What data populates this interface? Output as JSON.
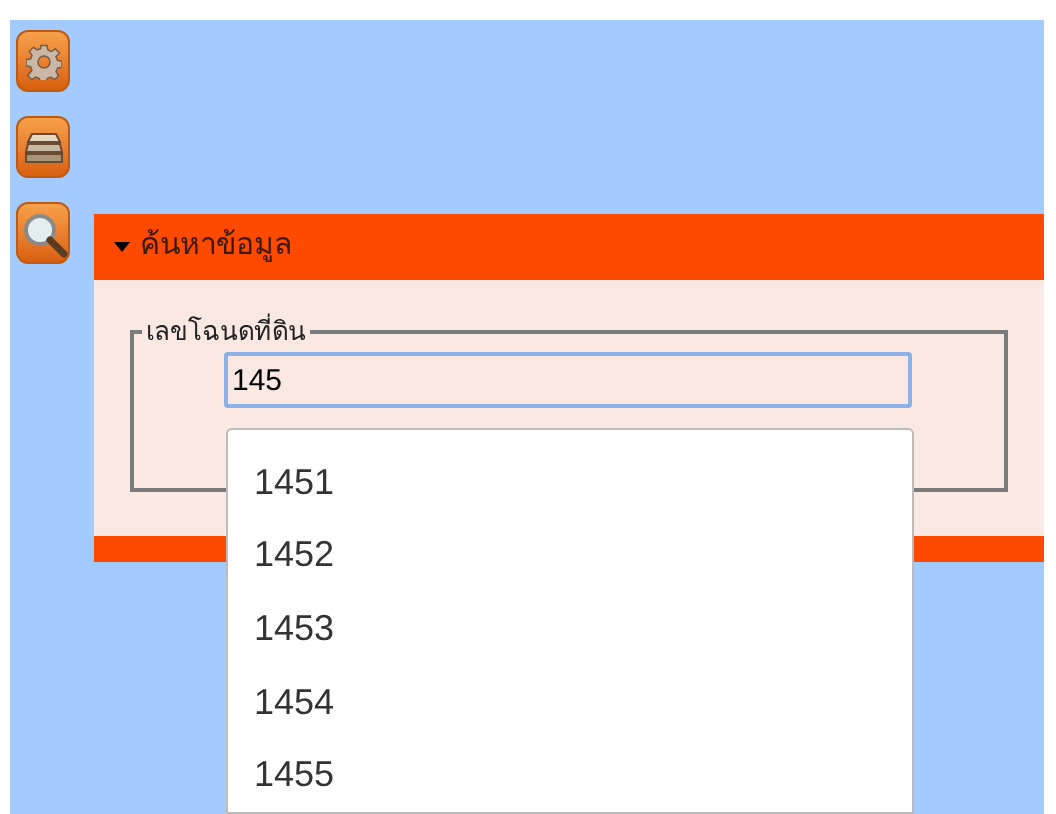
{
  "toolbar": [
    {
      "kind": "gear"
    },
    {
      "kind": "layers"
    },
    {
      "kind": "search"
    }
  ],
  "panel": {
    "title": "ค้นหาข้อมูล",
    "expanded": true,
    "fieldset": {
      "legend": "เลขโฉนดที่ดิน",
      "value": "145"
    }
  },
  "suggestions": [
    "1451",
    "1452",
    "1453",
    "1454",
    "1455"
  ]
}
